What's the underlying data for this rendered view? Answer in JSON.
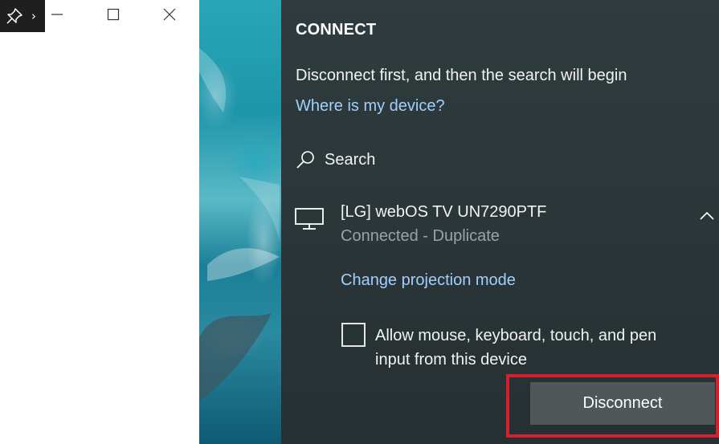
{
  "left_window": {
    "icons": [
      "pin-icon",
      "chevron-right-icon",
      "minimize-icon",
      "maximize-icon",
      "close-icon"
    ],
    "chevron_glyph": "›"
  },
  "connect": {
    "title": "CONNECT",
    "info": "Disconnect first, and then the search will begin",
    "where_link": "Where is my device?",
    "search_label": "Search",
    "device": {
      "name": "[LG] webOS TV UN7290PTF",
      "status": "Connected - Duplicate",
      "icon": "monitor-icon"
    },
    "change_projection": "Change projection mode",
    "allow_input": {
      "line1": "Allow mouse, keyboard, touch, and pen",
      "line2": "input from this device",
      "checked": false
    },
    "disconnect_label": "Disconnect"
  },
  "colors": {
    "panel_bg": "#2c3739",
    "link": "#9fd0ff",
    "button_bg": "#4f5759",
    "highlight": "#d4202a"
  }
}
